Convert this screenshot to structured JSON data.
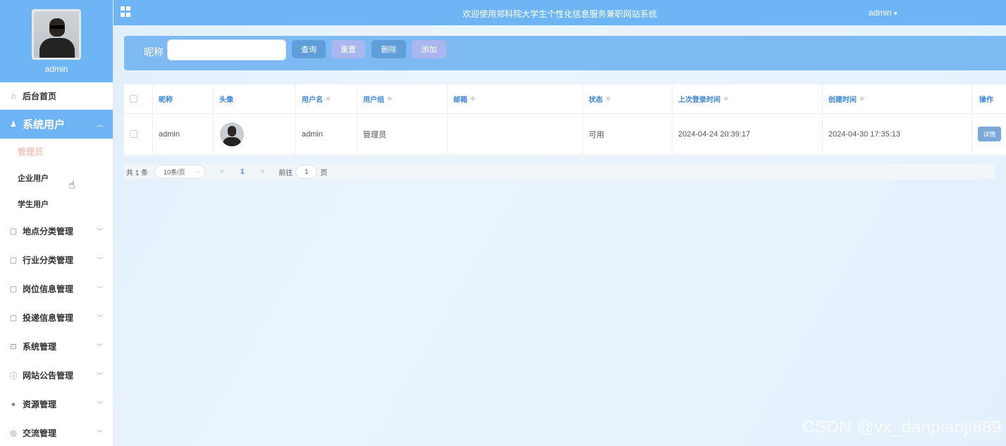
{
  "colors": {
    "primary": "#6db5f5",
    "active_sub": "#f5a99a",
    "header_text": "#3b86d8"
  },
  "sidebar": {
    "username": "admin",
    "items": [
      {
        "label": "后台首页",
        "icon": "home-icon",
        "glyph": "⌂"
      },
      {
        "label": "系统用户",
        "icon": "user-icon",
        "glyph": "♟",
        "active": true,
        "children": [
          "管理员",
          "企业用户",
          "学生用户"
        ]
      },
      {
        "label": "地点分类管理",
        "icon": "folder-icon",
        "glyph": "▢"
      },
      {
        "label": "行业分类管理",
        "icon": "folder-icon",
        "glyph": "▢"
      },
      {
        "label": "岗位信息管理",
        "icon": "folder-icon",
        "glyph": "▢"
      },
      {
        "label": "投递信息管理",
        "icon": "folder-icon",
        "glyph": "▢"
      },
      {
        "label": "系统管理",
        "icon": "picture-icon",
        "glyph": "⊡"
      },
      {
        "label": "网站公告管理",
        "icon": "info-icon",
        "glyph": "ⓘ"
      },
      {
        "label": "资源管理",
        "icon": "location-icon",
        "glyph": "●"
      },
      {
        "label": "交流管理",
        "icon": "chat-icon",
        "glyph": "◎"
      }
    ]
  },
  "topbar": {
    "title": "欢迎使用郑科院大学生个性化信息服务兼职网站系统",
    "user": "admin",
    "user_caret": "▾"
  },
  "search": {
    "label": "昵称",
    "value": "",
    "buttons": {
      "query": "查询",
      "reset": "重置",
      "delete": "删除",
      "add": "添加"
    }
  },
  "table": {
    "headers": [
      "昵称",
      "头像",
      "用户名",
      "用户组",
      "邮箱",
      "状态",
      "上次登录时间",
      "创建时间",
      "操作"
    ],
    "sort_glyph": "≑",
    "rows": [
      {
        "nickname": "admin",
        "username": "admin",
        "group": "管理员",
        "email": "",
        "status": "可用",
        "last_login": "2024-04-24 20:39:17",
        "created": "2024-04-30 17:35:13",
        "action": "详情"
      }
    ]
  },
  "pagination": {
    "total": "共 1 条",
    "page_size": "10条/页",
    "size_caret": "⌵",
    "prev": "<",
    "current": "1",
    "next": ">",
    "goto": "前往",
    "goto_value": "1",
    "page_suffix": "页"
  },
  "watermark": "CSDN @vx_danpianji889",
  "cursor": "☝"
}
